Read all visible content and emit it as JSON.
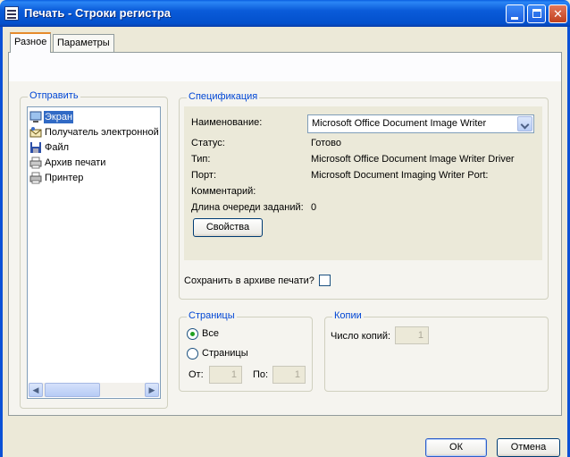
{
  "window": {
    "title": "Печать - Строки регистра"
  },
  "tabs": [
    {
      "label": "Разное",
      "active": true
    },
    {
      "label": "Параметры",
      "active": false
    }
  ],
  "send": {
    "legend": "Отправить",
    "items": [
      {
        "label": "Экран",
        "icon": "screen-icon",
        "selected": true
      },
      {
        "label": "Получатель электронной",
        "icon": "mail-recipient-icon",
        "selected": false
      },
      {
        "label": "Файл",
        "icon": "floppy-disk-icon",
        "selected": false
      },
      {
        "label": "Архив печати",
        "icon": "print-archive-icon",
        "selected": false
      },
      {
        "label": "Принтер",
        "icon": "printer-icon",
        "selected": false
      }
    ]
  },
  "spec": {
    "legend": "Спецификация",
    "name_label": "Наименование:",
    "name_value": "Microsoft Office Document Image Writer",
    "status_label": "Статус:",
    "status_value": "Готово",
    "type_label": "Тип:",
    "type_value": "Microsoft Office Document Image Writer Driver",
    "port_label": "Порт:",
    "port_value": "Microsoft Document Imaging Writer Port:",
    "comment_label": "Комментарий:",
    "comment_value": "",
    "queue_label": "Длина очереди заданий:",
    "queue_value": "0",
    "properties_button": "Свойства",
    "save_archive_label": "Сохранить в архиве печати?"
  },
  "pages": {
    "legend": "Страницы",
    "all_label": "Все",
    "range_label": "Страницы",
    "from_label": "От:",
    "from_value": "1",
    "to_label": "По:",
    "to_value": "1"
  },
  "copies": {
    "legend": "Копии",
    "count_label": "Число копий:",
    "count_value": "1"
  },
  "buttons": {
    "ok": "ОК",
    "cancel": "Отмена"
  },
  "colors": {
    "titlebar": "#0a5bd9",
    "legend": "#0046d5",
    "selection": "#316ac5"
  }
}
